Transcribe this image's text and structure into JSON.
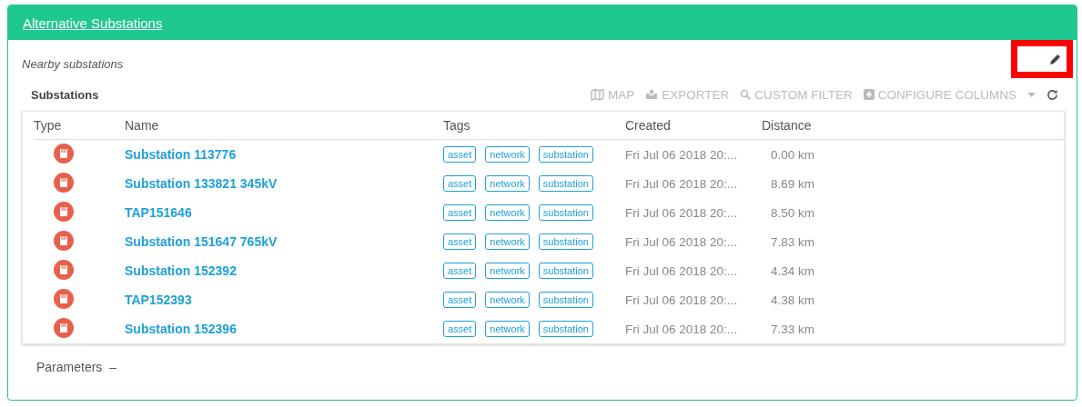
{
  "panel": {
    "title": "Alternative Substations",
    "subtitle": "Nearby substations",
    "section_title": "Substations",
    "toolbar": [
      {
        "kind": "map",
        "label": "MAP"
      },
      {
        "kind": "export",
        "label": "EXPORTER"
      },
      {
        "kind": "filter",
        "label": "CUSTOM FILTER"
      },
      {
        "kind": "columns",
        "label": "CONFIGURE COLUMNS"
      },
      {
        "kind": "refresh"
      }
    ],
    "table": {
      "columns": [
        "Type",
        "Name",
        "Tags",
        "Created",
        "Distance"
      ],
      "rows": [
        {
          "name": "Substation 113776",
          "tags": [
            "asset",
            "network",
            "substation"
          ],
          "created": "Fri Jul 06 2018 20:...",
          "distance": "0.00 km"
        },
        {
          "name": "Substation 133821 345kV",
          "tags": [
            "asset",
            "network",
            "substation"
          ],
          "created": "Fri Jul 06 2018 20:...",
          "distance": "8.69 km"
        },
        {
          "name": "TAP151646",
          "tags": [
            "asset",
            "network",
            "substation"
          ],
          "created": "Fri Jul 06 2018 20:...",
          "distance": "8.50 km"
        },
        {
          "name": "Substation 151647 765kV",
          "tags": [
            "asset",
            "network",
            "substation"
          ],
          "created": "Fri Jul 06 2018 20:...",
          "distance": "7.83 km"
        },
        {
          "name": "Substation 152392",
          "tags": [
            "asset",
            "network",
            "substation"
          ],
          "created": "Fri Jul 06 2018 20:...",
          "distance": "4.34 km"
        },
        {
          "name": "TAP152393",
          "tags": [
            "asset",
            "network",
            "substation"
          ],
          "created": "Fri Jul 06 2018 20:...",
          "distance": "4.38 km"
        },
        {
          "name": "Substation 152396",
          "tags": [
            "asset",
            "network",
            "substation"
          ],
          "created": "Fri Jul 06 2018 20:...",
          "distance": "7.33 km"
        }
      ]
    },
    "parameters": {
      "label": "Parameters",
      "toggle": "–"
    }
  }
}
